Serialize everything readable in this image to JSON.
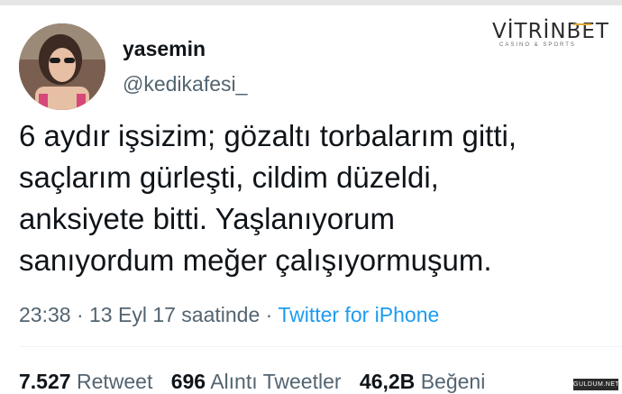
{
  "user": {
    "name": "yasemin",
    "handle": "@kedikafesi_"
  },
  "brand": {
    "logo_text": "VİTRİNBET",
    "logo_tagline": "CASINO & SPORTS",
    "accent_color": "#e2a93b"
  },
  "tweet": {
    "lines": [
      "6 aydır işsizim; gözaltı torbalarım gitti,",
      "saçlarım gürleşti, cildim düzeldi,",
      "anksiyete bitti. Yaşlanıyorum",
      "sanıyordum meğer çalışıyormuşum."
    ],
    "time": "23:38",
    "date": "13 Eyl 17 saatinde",
    "separator": "·",
    "source": "Twitter for iPhone",
    "link_color": "#1d9bf0"
  },
  "stats": {
    "retweets": {
      "count": "7.527",
      "label": "Retweet"
    },
    "quotes": {
      "count": "696",
      "label": "Alıntı Tweetler"
    },
    "likes": {
      "count": "46,2B",
      "label": "Beğeni"
    }
  },
  "watermark": {
    "text": "GULDUM.NET"
  }
}
